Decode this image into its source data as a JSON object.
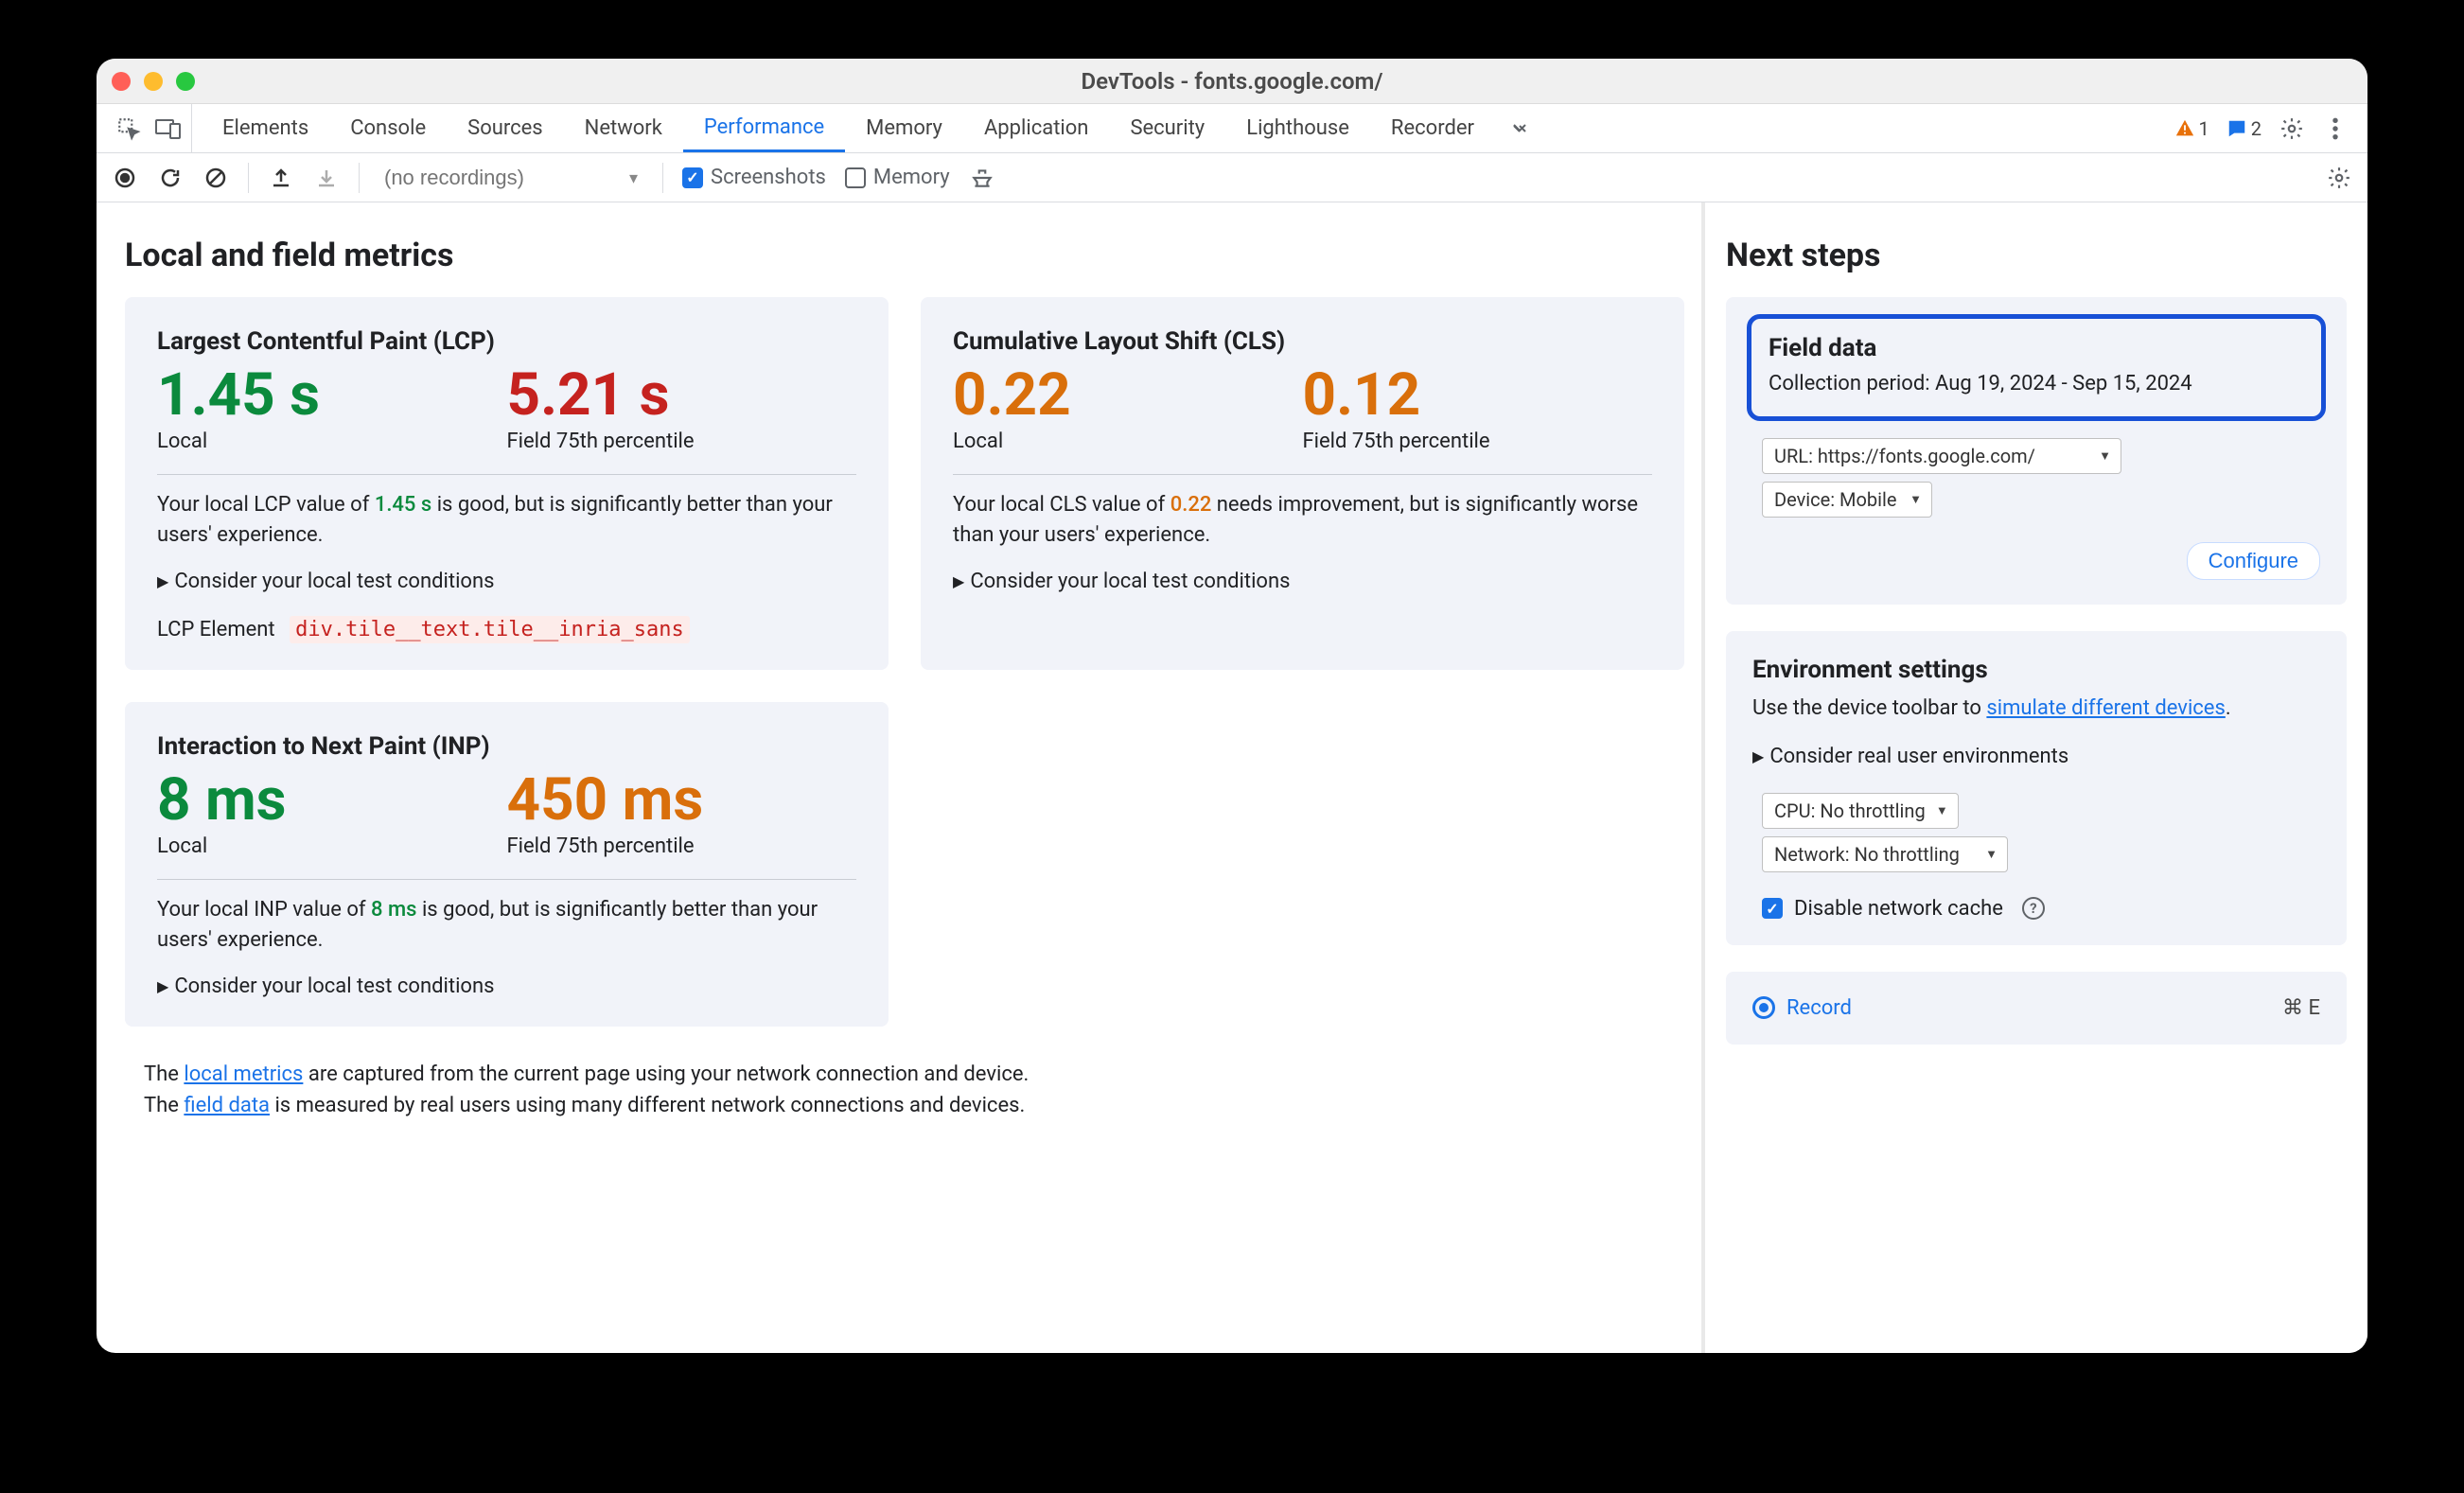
{
  "window": {
    "title": "DevTools - fonts.google.com/"
  },
  "tabs": [
    "Elements",
    "Console",
    "Sources",
    "Network",
    "Performance",
    "Memory",
    "Application",
    "Security",
    "Lighthouse",
    "Recorder"
  ],
  "active_tab": "Performance",
  "badges": {
    "warnings": "1",
    "messages": "2"
  },
  "toolbar": {
    "recordings_placeholder": "(no recordings)",
    "screenshots_label": "Screenshots",
    "memory_label": "Memory"
  },
  "main": {
    "heading": "Local and field metrics",
    "lcp": {
      "title": "Largest Contentful Paint (LCP)",
      "local_value": "1.45 s",
      "local_label": "Local",
      "field_value": "5.21 s",
      "field_label": "Field 75th percentile",
      "desc_pre": "Your local LCP value of ",
      "desc_val": "1.45 s",
      "desc_post": " is good, but is significantly better than your users' experience.",
      "disclose": "Consider your local test conditions",
      "element_label": "LCP Element",
      "element_selector": "div.tile__text.tile__inria_sans"
    },
    "cls": {
      "title": "Cumulative Layout Shift (CLS)",
      "local_value": "0.22",
      "local_label": "Local",
      "field_value": "0.12",
      "field_label": "Field 75th percentile",
      "desc_pre": "Your local CLS value of ",
      "desc_val": "0.22",
      "desc_post": " needs improvement, but is significantly worse than your users' experience.",
      "disclose": "Consider your local test conditions"
    },
    "inp": {
      "title": "Interaction to Next Paint (INP)",
      "local_value": "8 ms",
      "local_label": "Local",
      "field_value": "450 ms",
      "field_label": "Field 75th percentile",
      "desc_pre": "Your local INP value of ",
      "desc_val": "8 ms",
      "desc_post": " is good, but is significantly better than your users' experience.",
      "disclose": "Consider your local test conditions"
    },
    "footer": {
      "line1_pre": "The ",
      "line1_link": "local metrics",
      "line1_post": " are captured from the current page using your network connection and device.",
      "line2_pre": "The ",
      "line2_link": "field data",
      "line2_post": " is measured by real users using many different network connections and devices."
    }
  },
  "side": {
    "heading": "Next steps",
    "fielddata": {
      "title": "Field data",
      "period_label": "Collection period: ",
      "period_value": "Aug 19, 2024 - Sep 15, 2024",
      "url_select": "URL: https://fonts.google.com/",
      "device_select": "Device: Mobile",
      "configure": "Configure"
    },
    "env": {
      "title": "Environment settings",
      "text_pre": "Use the device toolbar to ",
      "text_link": "simulate different devices",
      "text_post": ".",
      "disclose": "Consider real user environments",
      "cpu_select": "CPU: No throttling",
      "network_select": "Network: No throttling",
      "disable_cache": "Disable network cache"
    },
    "record": {
      "label": "Record",
      "shortcut": "⌘ E"
    }
  }
}
